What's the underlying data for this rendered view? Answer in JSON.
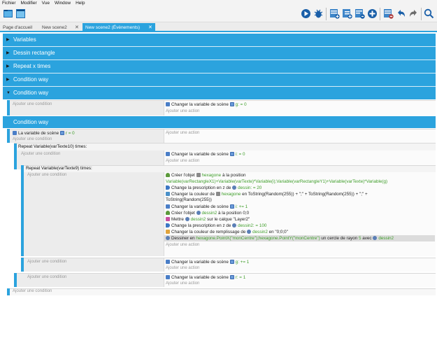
{
  "menubar": [
    "Fichier",
    "Modifier",
    "Vue",
    "Window",
    "Help"
  ],
  "tabs": [
    {
      "label": "Page d'accueil"
    },
    {
      "label": "New scene2",
      "close": "✕"
    },
    {
      "label": "New scene2 (Évènements)",
      "close": "✕",
      "active": true
    }
  ],
  "toolbar": {
    "left": [
      "project-manager-icon",
      "scene-editor-icon"
    ],
    "right": [
      "preview-icon",
      "debug-icon",
      "add-event-icon",
      "add-subevent-icon",
      "add-comment-icon",
      "add-more-icon",
      "remove-icon",
      "undo-icon",
      "redo-icon",
      "search-icon"
    ]
  },
  "groups": [
    {
      "title": "Variables"
    },
    {
      "title": "Dessin rectangle"
    },
    {
      "title": "Repeat x times"
    },
    {
      "title": "Condition way"
    },
    {
      "title": "Condition way"
    }
  ],
  "placeholders": {
    "add_condition": "Ajouter une condition",
    "add_action": "Ajouter une action"
  },
  "event1": {
    "action": "Changer la variable de scène",
    "var": "g",
    "rest": ": = 0"
  },
  "group6": {
    "title": "Condition way"
  },
  "event2": {
    "cond": "La variable de scène",
    "var": "r",
    "rest": "= 0"
  },
  "repeat1": {
    "header": "Repeat Variable(varTexte10) times:",
    "action": "Changer la variable de scène",
    "var": "i",
    "rest": ": = 0"
  },
  "repeat2": {
    "header": "Repeat Variable(varTexte9) times:",
    "actions": [
      {
        "a": "Créer l'objet",
        "b": "hexagone",
        "c": "à la position"
      },
      {
        "a": "Variable(varRectangleX1)+Variable(varTexte)*Variable(i);Variable(varRectangleY1)+Variable(varTexte)*Variable(g)"
      },
      {
        "a": "Change la prescription en z de",
        "b": "dessin",
        "c": ": = 20"
      },
      {
        "a": "Changer la couleur de",
        "b": "hexagone",
        "c": "en ToString(Random(255)) + \";\" + ToString(Random(255)) + \";\" +"
      },
      {
        "a": "ToString(Random(255))"
      },
      {
        "a": "Changer la variable de scène",
        "b": "i",
        "c": ": += 1"
      },
      {
        "a": "Créer l'objet",
        "b": "dessin2",
        "c": "à la position 0;0"
      },
      {
        "a": "Mettre",
        "b": "dessin2",
        "c": "sur le calque \"Layer2\""
      },
      {
        "a": "Change la prescription en z de",
        "b": "dessin2",
        "c": ": = 100"
      },
      {
        "a": "Changer la couleur de remplissage de",
        "b": "dessin2",
        "c": "en \"0;0;0\""
      },
      {
        "a": "Dessiner en",
        "b": "hexagone.PointX(\"monCentre\");hexagone.PointY(\"monCentre\")",
        "c": "un cercle de rayon",
        "d": "5",
        "e": "avec",
        "f": "dessin2"
      }
    ]
  },
  "after_repeat2": {
    "action": "Changer la variable de scène",
    "var": "g",
    "rest": ": += 1"
  },
  "after_repeat1": {
    "action": "Changer la variable de scène",
    "var": "r",
    "rest": ": = 1"
  }
}
